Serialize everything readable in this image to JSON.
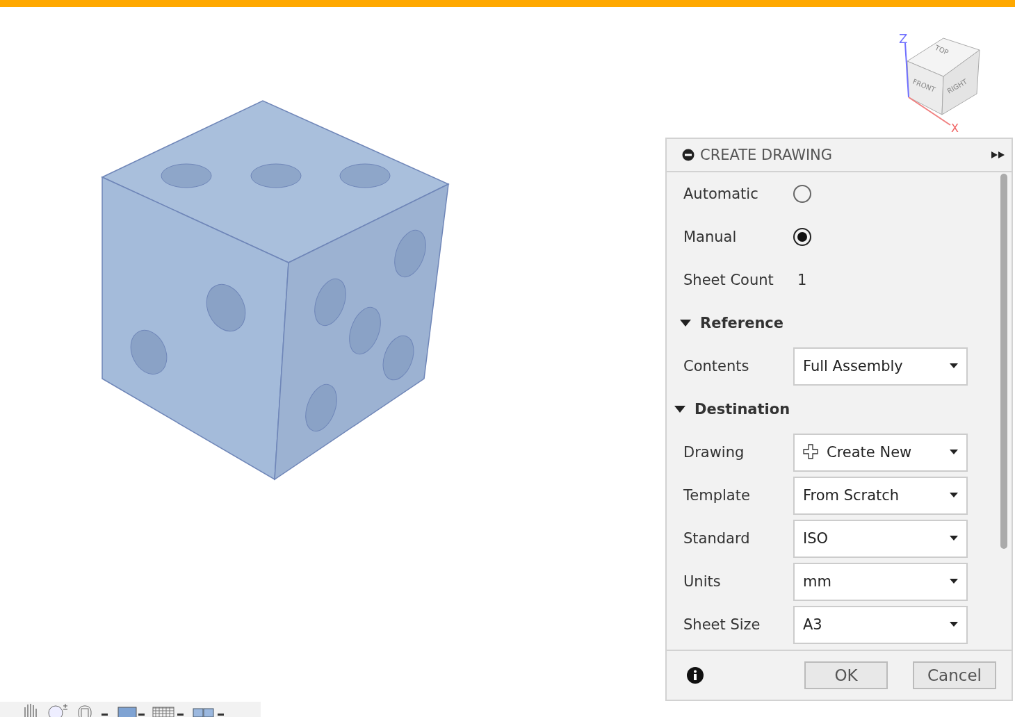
{
  "view_cube": {
    "top": "TOP",
    "front": "FRONT",
    "right": "RIGHT",
    "z_axis": "Z",
    "x_axis": "X"
  },
  "panel": {
    "title": "CREATE DRAWING",
    "rows": [
      {
        "kind": "radio",
        "label": "Automatic",
        "selected": false
      },
      {
        "kind": "radio",
        "label": "Manual",
        "selected": true
      },
      {
        "kind": "value",
        "label": "Sheet Count",
        "value": "1"
      },
      {
        "kind": "section",
        "label": "Reference",
        "expanded": true
      },
      {
        "kind": "dropdown",
        "label": "Contents",
        "value": "Full Assembly"
      },
      {
        "kind": "section",
        "label": "Destination",
        "expanded": true
      },
      {
        "kind": "new_dropdown",
        "label": "Drawing",
        "value": "Create New"
      },
      {
        "kind": "dropdown",
        "label": "Template",
        "value": "From Scratch"
      },
      {
        "kind": "dropdown",
        "label": "Standard",
        "value": "ISO"
      },
      {
        "kind": "dropdown",
        "label": "Units",
        "value": "mm"
      },
      {
        "kind": "dropdown",
        "label": "Sheet Size",
        "value": "A3"
      }
    ],
    "buttons": [
      "OK",
      "Cancel"
    ]
  }
}
